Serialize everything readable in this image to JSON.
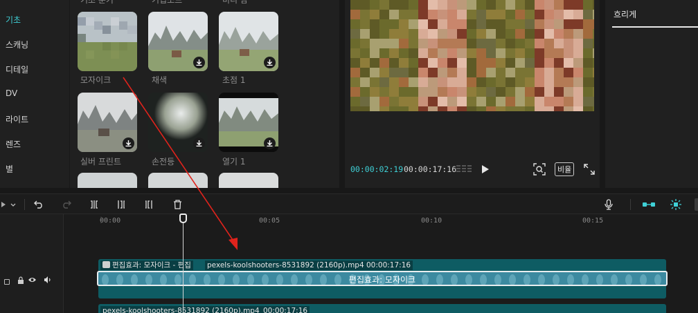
{
  "categories": [
    {
      "label": "기초",
      "active": true
    },
    {
      "label": "스캐닝",
      "active": false
    },
    {
      "label": "디테일",
      "active": false
    },
    {
      "label": "DV",
      "active": false
    },
    {
      "label": "라이트",
      "active": false
    },
    {
      "label": "렌즈",
      "active": false
    },
    {
      "label": "별",
      "active": false
    }
  ],
  "effects_top_partial_labels": [
    "기초 분기",
    "기입소드",
    "비디 암"
  ],
  "effects": [
    {
      "label": "모자이크",
      "icon": "pixelated-landscape"
    },
    {
      "label": "채색",
      "icon": "download-icon"
    },
    {
      "label": "초점 1",
      "icon": "download-icon"
    },
    {
      "label": "실버 프린트",
      "icon": "download-icon"
    },
    {
      "label": "손전등",
      "icon": "download-icon"
    },
    {
      "label": "열기 1",
      "icon": "download-icon"
    }
  ],
  "preview": {
    "current_time": "00:00:02:19",
    "total_time": "00:00:17:16",
    "ratio_label": "비율"
  },
  "right_panel": {
    "tab_label": "흐리게"
  },
  "timeline": {
    "ticks": [
      "00:00",
      "00:05",
      "00:10",
      "00:15"
    ],
    "ruler_markers": [
      "|",
      "|",
      "|"
    ],
    "effect_chip": "편집효과: 모자이크 - 편집",
    "clip_name": "pexels-koolshooters-8531892 (2160p).mp4",
    "clip_duration": "00:00:17:16",
    "selected_effect_label": "편집효과:  모자이크",
    "clip2_name": "pexels-koolshooters-8531892 (2160p).mp4",
    "clip2_duration": "00:00:17:16"
  },
  "colors": {
    "accent": "#3fd0d6",
    "clip": "#0e5c63",
    "annotation": "#e0231c"
  }
}
